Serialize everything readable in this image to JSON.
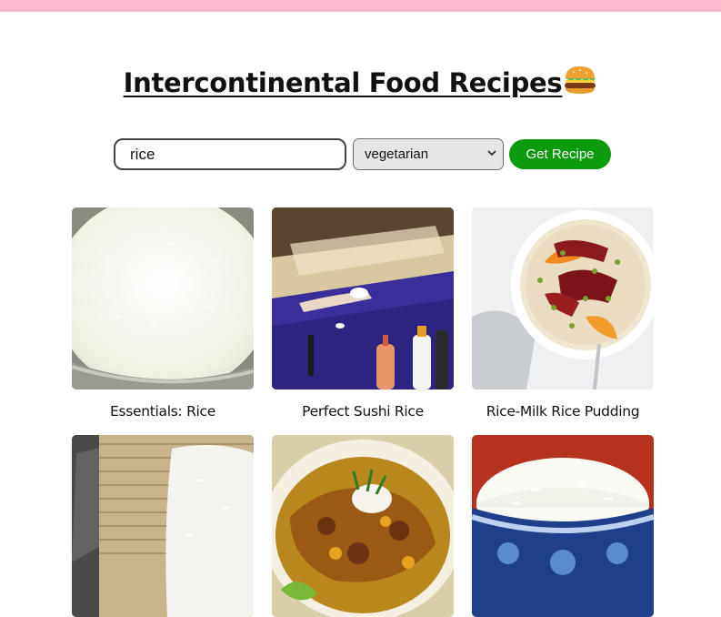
{
  "header": {
    "title": "Intercontinental Food Recipes",
    "title_icon": "hamburger-emoji"
  },
  "search": {
    "query": "rice",
    "diet_selected": "vegetarian",
    "button_label": "Get Recipe"
  },
  "colors": {
    "top_bar": "#fbbbd2",
    "button": "#0b9a0b"
  },
  "recipes": [
    {
      "title": "Essentials: Rice",
      "image": "steamed-white-rice-in-pot"
    },
    {
      "title": "Perfect Sushi Rice",
      "image": "sushi-preparation"
    },
    {
      "title": "Rice-Milk Rice Pudding",
      "image": "rice-pudding-bowl"
    },
    {
      "title": "",
      "image": "sushi-rice-on-bamboo-mat"
    },
    {
      "title": "",
      "image": "curry-plate"
    },
    {
      "title": "",
      "image": "rice-in-blue-bowl"
    }
  ]
}
